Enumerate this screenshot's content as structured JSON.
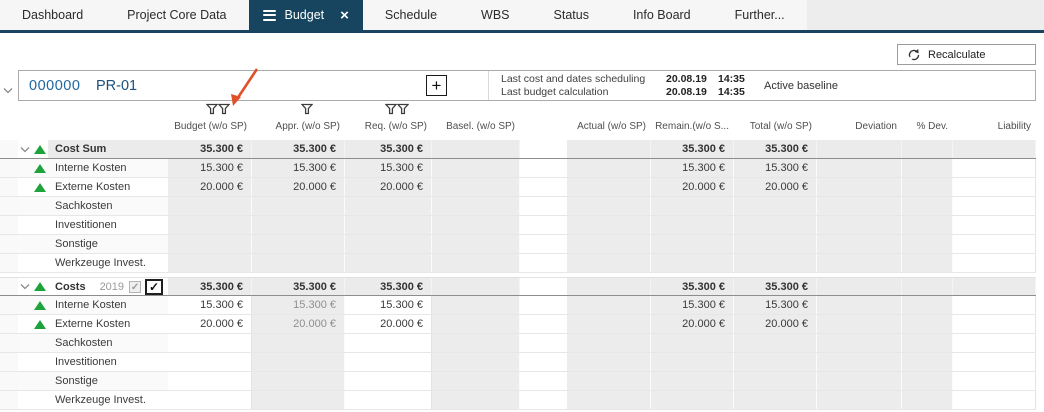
{
  "colors": {
    "navy": "#17455f",
    "green": "#1ea33c",
    "annotation_arrow": "#e0512a",
    "link_blue": "#2167a0"
  },
  "tabs": {
    "active": "Budget",
    "items": [
      {
        "label": "Dashboard"
      },
      {
        "label": "Project Core Data"
      },
      {
        "label": "Budget"
      },
      {
        "label": "Schedule"
      },
      {
        "label": "WBS"
      },
      {
        "label": "Status"
      },
      {
        "label": "Info Board"
      },
      {
        "label": "Further..."
      }
    ]
  },
  "toolbar": {
    "recalculate_label": "Recalculate"
  },
  "project": {
    "code": "000000",
    "name": "PR-01",
    "add_button": "+",
    "info_rows": [
      {
        "label": "Last cost and dates scheduling",
        "date": "20.08.19",
        "time": "14:35"
      },
      {
        "label": "Last budget calculation",
        "date": "20.08.19",
        "time": "14:35"
      }
    ],
    "baseline": "Active baseline"
  },
  "table": {
    "columns": [
      {
        "key": "budget",
        "label": "Budget (w/o SP)",
        "filters": 2
      },
      {
        "key": "appr",
        "label": "Appr. (w/o SP)",
        "filters": 1
      },
      {
        "key": "req",
        "label": "Req. (w/o SP)",
        "filters": 2
      },
      {
        "key": "basel",
        "label": "Basel. (w/o SP)",
        "filters": 0
      },
      {
        "key": "gap",
        "label": "",
        "filters": 0
      },
      {
        "key": "actual",
        "label": "Actual (w/o SP)",
        "filters": 0
      },
      {
        "key": "remain",
        "label": "Remain.(w/o S...",
        "filters": 0
      },
      {
        "key": "total",
        "label": "Total (w/o SP)",
        "filters": 0
      },
      {
        "key": "deviation",
        "label": "Deviation",
        "filters": 0
      },
      {
        "key": "pdev",
        "label": "% Dev.",
        "filters": 0
      },
      {
        "key": "liability",
        "label": "Liability",
        "filters": 0
      }
    ],
    "groups": [
      {
        "editable": false,
        "header": {
          "label": "Cost Sum",
          "values": {
            "budget": "35.300 €",
            "appr": "35.300 €",
            "req": "35.300 €",
            "remain": "35.300 €",
            "total": "35.300 €"
          }
        },
        "rows": [
          {
            "label": "Interne Kosten",
            "trend": "up",
            "values": {
              "budget": "15.300 €",
              "appr": "15.300 €",
              "req": "15.300 €",
              "remain": "15.300 €",
              "total": "15.300 €"
            }
          },
          {
            "label": "Externe Kosten",
            "trend": "up",
            "values": {
              "budget": "20.000 €",
              "appr": "20.000 €",
              "req": "20.000 €",
              "remain": "20.000 €",
              "total": "20.000 €"
            }
          },
          {
            "label": "Sachkosten",
            "trend": null,
            "values": {}
          },
          {
            "label": "Investitionen",
            "trend": null,
            "values": {}
          },
          {
            "label": "Sonstige",
            "trend": null,
            "values": {}
          },
          {
            "label": "Werkzeuge Invest.",
            "trend": null,
            "values": {}
          }
        ]
      },
      {
        "editable": true,
        "header": {
          "label": "Costs",
          "year": "2019",
          "checkboxes": [
            {
              "state": "checked-disabled"
            },
            {
              "state": "checked"
            }
          ],
          "values": {
            "budget": "35.300 €",
            "appr": "35.300 €",
            "req": "35.300 €",
            "remain": "35.300 €",
            "total": "35.300 €"
          }
        },
        "rows": [
          {
            "label": "Interne Kosten",
            "trend": "up",
            "values": {
              "budget": "15.300 €",
              "appr": "15.300 €",
              "req": "15.300 €",
              "remain": "15.300 €",
              "total": "15.300 €"
            }
          },
          {
            "label": "Externe Kosten",
            "trend": "up",
            "values": {
              "budget": "20.000 €",
              "appr": "20.000 €",
              "req": "20.000 €",
              "remain": "20.000 €",
              "total": "20.000 €"
            }
          },
          {
            "label": "Sachkosten",
            "trend": null,
            "values": {}
          },
          {
            "label": "Investitionen",
            "trend": null,
            "values": {}
          },
          {
            "label": "Sonstige",
            "trend": null,
            "values": {}
          },
          {
            "label": "Werkzeuge Invest.",
            "trend": null,
            "values": {}
          }
        ]
      }
    ]
  }
}
